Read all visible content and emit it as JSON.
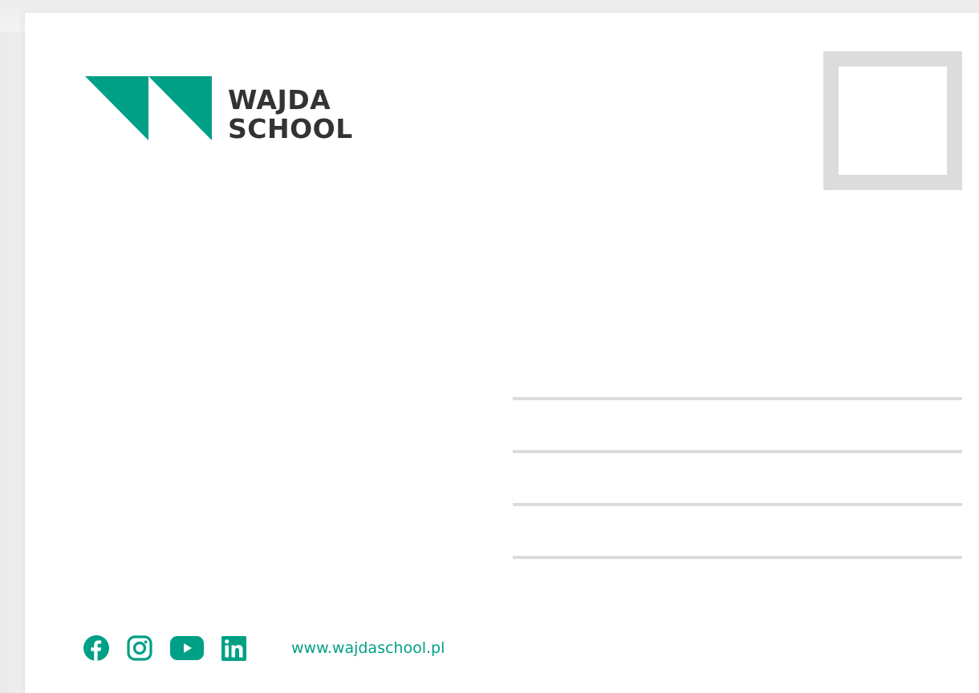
{
  "brand": {
    "line1": "WAJDA",
    "line2": "SCHOOL",
    "accent_color": "#00a086",
    "text_color": "#333333"
  },
  "stamp": {
    "border_color": "#dcdcdc"
  },
  "address_lines": 4,
  "social_icons": [
    "facebook-icon",
    "instagram-icon",
    "youtube-icon",
    "linkedin-icon"
  ],
  "website": "www.wajdaschool.pl"
}
